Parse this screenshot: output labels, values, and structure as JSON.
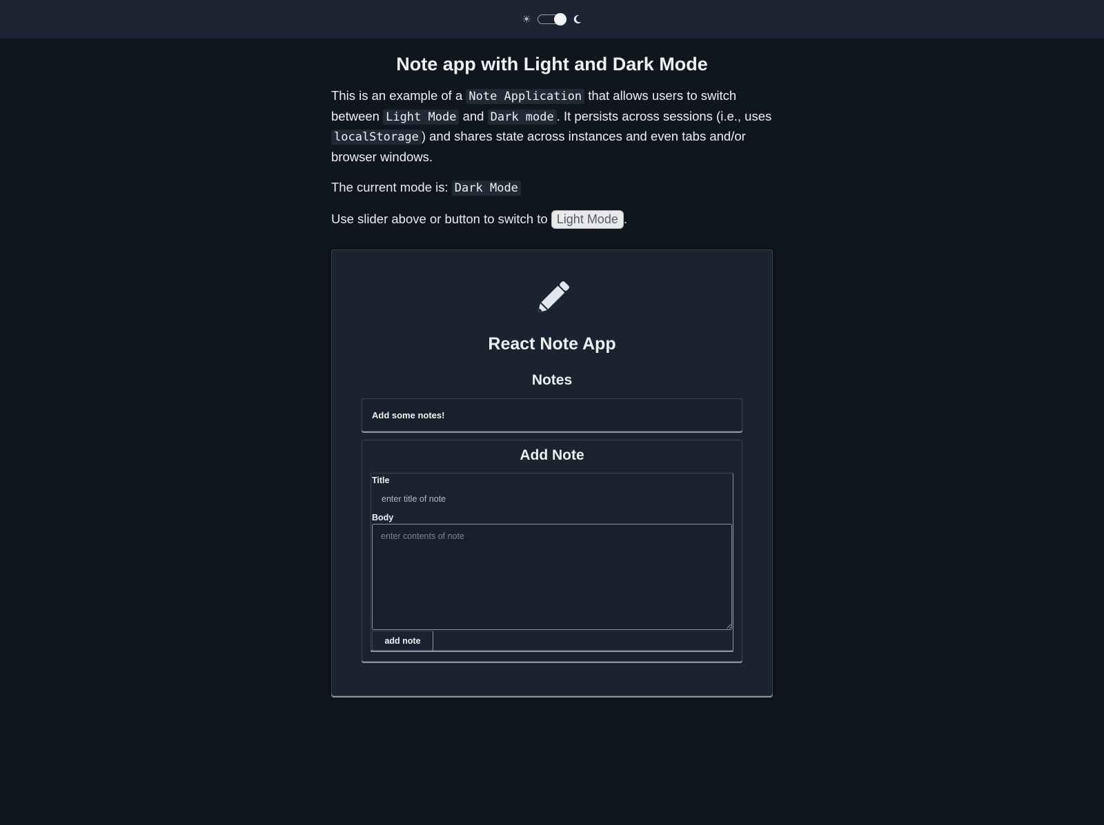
{
  "topbar": {
    "theme_toggle_checked": true,
    "icons": [
      "sun-icon",
      "moon-icon"
    ]
  },
  "header": {
    "title": "Note app with Light and Dark Mode"
  },
  "intro": {
    "t1": "This is an example of a ",
    "c1": "Note Application",
    "t2": " that allows users to switch between ",
    "c2": "Light Mode",
    "t3": " and ",
    "c3": "Dark mode",
    "t4": ". It persists across sessions (i.e., uses ",
    "c4": "localStorage",
    "t5": ") and shares state across instances and even tabs and/or browser windows."
  },
  "mode": {
    "label": "The current mode is: ",
    "value": "Dark Mode"
  },
  "switch": {
    "text": "Use slider above or button to switch to ",
    "button_label": "Light Mode",
    "suffix": "."
  },
  "app": {
    "icon": "pencil-icon",
    "title": "React Note App",
    "notes_heading": "Notes",
    "empty_notes": "Add some notes!",
    "add_heading": "Add Note",
    "title_label": "Title",
    "title_placeholder": "enter title of note",
    "title_value": "",
    "body_label": "Body",
    "body_placeholder": "enter contents of note",
    "body_value": "",
    "add_button": "add note"
  },
  "colors": {
    "background": "#10161e",
    "topbar": "#1b2533",
    "card": "#1a2431",
    "code_bg": "#202a37",
    "text": "#eef1f4",
    "border_highlight": "#8e969f"
  }
}
